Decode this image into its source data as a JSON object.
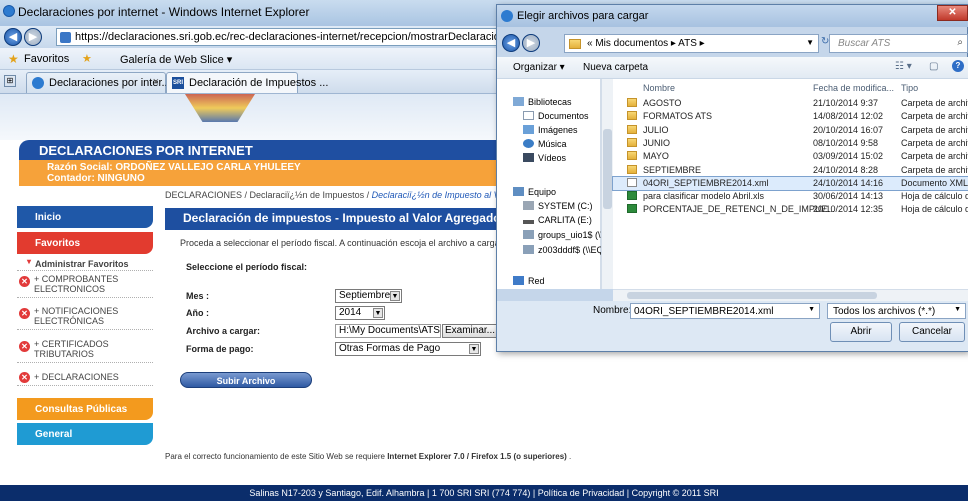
{
  "browser": {
    "window_title": "Declaraciones por internet - Windows Internet Explorer",
    "address": "https://declaraciones.sri.gob.ec/rec-declaraciones-internet/recepcion/mostrarDeclaracion.jspa?codTI=43&co",
    "favorites_label": "Favoritos",
    "webslice_label": "Galería de Web Slice ▾",
    "tabs": [
      {
        "label": "Declaraciones por inter...",
        "close": "×"
      },
      {
        "label": "Declaración de Impuestos ..."
      }
    ]
  },
  "site": {
    "header_title": "DECLARACIONES POR INTERNET",
    "razon_social": "Razón Social: ORDOÑEZ VALLEJO CARLA YHULEEY",
    "contador": "Contador: NINGUNO",
    "breadcrumb_plain": "DECLARACIONES / Declaraciï¿½n de Impuestos /",
    "breadcrumb_current": "Declaraciï¿½n de Impuesto al V",
    "sidebar": {
      "inicio": "Inicio",
      "favoritos": "Favoritos",
      "administrar": "Administrar Favoritos",
      "items": [
        "+ COMPROBANTES ELECTRONICOS",
        "+ NOTIFICACIONES ELECTRÓNICAS",
        "+ CERTIFICADOS TRIBUTARIOS",
        "+ DECLARACIONES"
      ],
      "consultas": "Consultas Públicas",
      "general": "General"
    },
    "main_title": "Declaración de impuestos - Impuesto al Valor Agregado (Mens",
    "instruction": "Proceda a seleccionar el período fiscal. A continuación escoja el archivo a cargar",
    "period_label": "Seleccione el período fiscal:",
    "form": {
      "mes_label": "Mes :",
      "mes_value": "Septiembre",
      "anio_label": "Año :",
      "anio_value": "2014",
      "archivo_label": "Archivo a cargar:",
      "archivo_value": "H:\\My Documents\\ATS\\",
      "examinar": "Examinar...",
      "pago_label": "Forma de pago:",
      "pago_value": "Otras Formas de Pago"
    },
    "submit_label": "Subir Archivo",
    "requirement_prefix": "Para el correcto funcionamiento de este Sitio Web se requiere ",
    "requirement_bold": "Internet Explorer 7.0 / Firefox 1.5 (o superiores)",
    "requirement_suffix": " .",
    "footer": "Salinas N17-203 y Santiago, Edif. Alhambra | 1 700 SRI SRI (774 774) | Política de Privacidad | Copyright © 2011 SRI"
  },
  "dialog": {
    "title": "Elegir archivos para cargar",
    "path": "« Mis documentos ▸ ATS ▸",
    "search_placeholder": "Buscar ATS",
    "organize": "Organizar ▾",
    "new_folder": "Nueva carpeta",
    "nav": [
      {
        "label": "Bibliotecas",
        "icon": "library-icon"
      },
      {
        "label": "Documentos",
        "icon": "documents-icon"
      },
      {
        "label": "Imágenes",
        "icon": "pictures-icon"
      },
      {
        "label": "Música",
        "icon": "music-icon"
      },
      {
        "label": "Vídeos",
        "icon": "videos-icon"
      },
      {
        "label": "Equipo",
        "icon": "computer-icon"
      },
      {
        "label": "SYSTEM (C:)",
        "icon": "drive-icon"
      },
      {
        "label": "CARLITA (E:)",
        "icon": "drive-icon"
      },
      {
        "label": "groups_uio1$ (\\\\",
        "icon": "network-drive-icon"
      },
      {
        "label": "z003dddf$ (\\\\EQU",
        "icon": "network-drive-icon"
      },
      {
        "label": "Red",
        "icon": "network-icon"
      }
    ],
    "columns": [
      "Nombre",
      "Fecha de modifica...",
      "Tipo"
    ],
    "files": [
      {
        "name": "AGOSTO",
        "date": "21/10/2014 9:37",
        "type": "Carpeta de archivo",
        "kind": "folder"
      },
      {
        "name": "FORMATOS ATS",
        "date": "14/08/2014 12:02",
        "type": "Carpeta de archivo",
        "kind": "folder"
      },
      {
        "name": "JULIO",
        "date": "20/10/2014 16:07",
        "type": "Carpeta de archivo",
        "kind": "folder"
      },
      {
        "name": "JUNIO",
        "date": "08/10/2014 9:58",
        "type": "Carpeta de archivo",
        "kind": "folder"
      },
      {
        "name": "MAYO",
        "date": "03/09/2014 15:02",
        "type": "Carpeta de archivo",
        "kind": "folder"
      },
      {
        "name": "SEPTIEMBRE",
        "date": "24/10/2014 8:28",
        "type": "Carpeta de archivo",
        "kind": "folder"
      },
      {
        "name": "04ORI_SEPTIEMBRE2014.xml",
        "date": "24/10/2014 14:16",
        "type": "Documento XML",
        "kind": "xml",
        "selected": true
      },
      {
        "name": "para clasificar modelo Abril.xls",
        "date": "30/06/2014 14:13",
        "type": "Hoja de cálculo d...",
        "kind": "xls"
      },
      {
        "name": "PORCENTAJE_DE_RETENCI_N_DE_IMPUE...",
        "date": "20/10/2014 12:35",
        "type": "Hoja de cálculo d...",
        "kind": "xls"
      }
    ],
    "filename_label": "Nombre:",
    "filename_value": "04ORI_SEPTIEMBRE2014.xml",
    "filter": "Todos los archivos (*.*)",
    "open": "Abrir",
    "cancel": "Cancelar"
  }
}
